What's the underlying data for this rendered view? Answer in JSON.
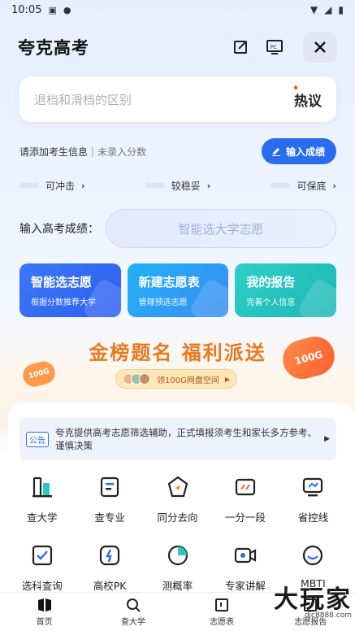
{
  "status": {
    "time": "10:05"
  },
  "header": {
    "title": "夸克高考"
  },
  "search": {
    "placeholder": "退档和滑档的区别",
    "hot_label": "热议"
  },
  "info": {
    "add_text": "请添加考生信息",
    "sep": "|",
    "no_score": "未录入分数",
    "score_button": "输入成绩"
  },
  "tiers": [
    {
      "label": "可冲击"
    },
    {
      "label": "较稳妥"
    },
    {
      "label": "可保底"
    }
  ],
  "score_input": {
    "label": "输入高考成绩：",
    "placeholder": "智能选大学志愿"
  },
  "cards": [
    {
      "title": "智能选志愿",
      "sub": "根据分数推荐大学"
    },
    {
      "title": "新建志愿表",
      "sub": "管理预选志愿"
    },
    {
      "title": "我的报告",
      "sub": "完善个人信息"
    }
  ],
  "banner": {
    "title": "金榜题名 福利派送",
    "pill_text": "领100G网盘空间",
    "badge_left": "100G",
    "badge_right": "100G"
  },
  "notice": {
    "tag": "公告",
    "text": "夸克提供高考志愿筛选辅助，正式填报须考生和家长多方参考、谨慎决策"
  },
  "tools_row1": [
    {
      "label": "查大学",
      "icon": "building-icon"
    },
    {
      "label": "查专业",
      "icon": "book-icon"
    },
    {
      "label": "同分去向",
      "icon": "compass-icon"
    },
    {
      "label": "一分一段",
      "icon": "ruler-icon"
    },
    {
      "label": "省控线",
      "icon": "monitor-icon"
    }
  ],
  "tools_row2": [
    {
      "label": "选科查询",
      "icon": "check-icon"
    },
    {
      "label": "高校PK",
      "icon": "pk-icon"
    },
    {
      "label": "测概率",
      "icon": "pie-icon"
    },
    {
      "label": "专家讲解",
      "icon": "video-icon"
    },
    {
      "label": "MBTI",
      "icon": "face-icon"
    }
  ],
  "nav": [
    {
      "label": "首页",
      "icon": "home-icon"
    },
    {
      "label": "查大学",
      "icon": "search-icon"
    },
    {
      "label": "志愿表",
      "icon": "table-icon"
    },
    {
      "label": "志愿报告",
      "icon": "report-icon"
    }
  ],
  "watermark": {
    "title": "大玩家",
    "site": "djc8888.com"
  },
  "colors": {
    "accent": "#2a6cf0",
    "orange": "#e87a1e"
  }
}
